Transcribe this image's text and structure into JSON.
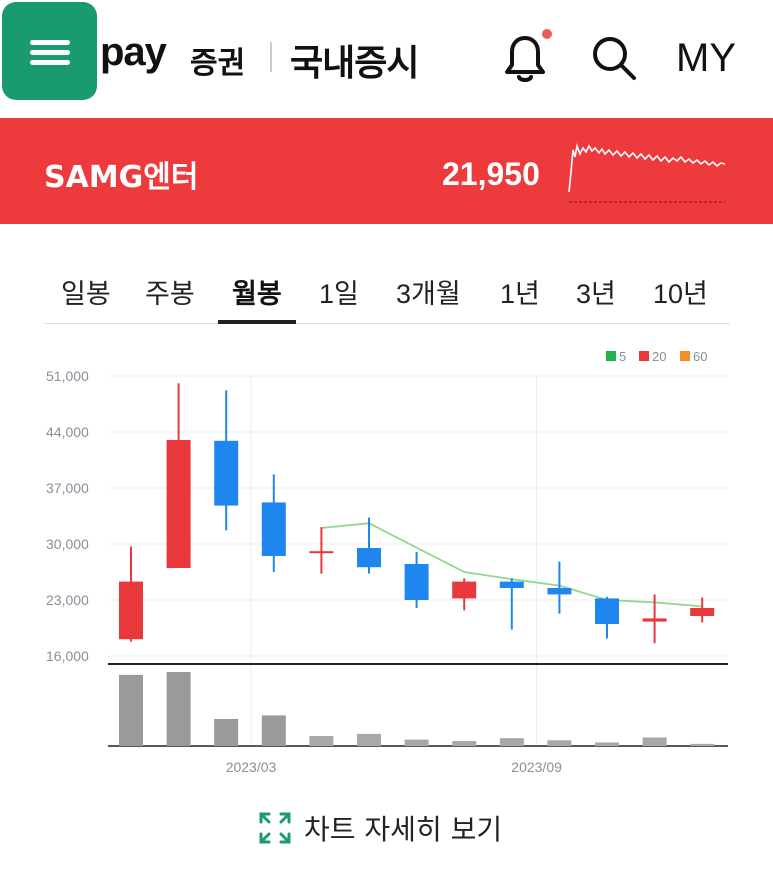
{
  "header": {
    "brand": "pay",
    "brand_sub": "증권",
    "section_title": "국내증시",
    "my_label": "MY",
    "notification_dot_color": "#f05a5a",
    "menu_color": "#1a9a70"
  },
  "stock": {
    "name": "SAMG엔터",
    "price": "21,950",
    "banner_color": "#ec3a3d"
  },
  "tabs": [
    {
      "label": "일봉",
      "active": false
    },
    {
      "label": "주봉",
      "active": false
    },
    {
      "label": "월봉",
      "active": true
    },
    {
      "label": "1일",
      "active": false
    },
    {
      "label": "3개월",
      "active": false
    },
    {
      "label": "1년",
      "active": false
    },
    {
      "label": "3년",
      "active": false
    },
    {
      "label": "10년",
      "active": false
    }
  ],
  "chart_data": {
    "type": "candlestick",
    "ylim": [
      16000,
      51000
    ],
    "y_ticks": [
      "51,000",
      "44,000",
      "37,000",
      "30,000",
      "23,000",
      "16,000"
    ],
    "y_tick_values": [
      51000,
      44000,
      37000,
      30000,
      23000,
      16000
    ],
    "x_tick_labels": [
      "2023/03",
      "2023/09"
    ],
    "x_tick_index": [
      3,
      9
    ],
    "legend": [
      {
        "label": "5",
        "color": "#22b14c"
      },
      {
        "label": "20",
        "color": "#e8383b"
      },
      {
        "label": "60",
        "color": "#f0922b"
      }
    ],
    "up_color": "#e8383b",
    "down_color": "#1f86f0",
    "ma_color": "#8fd98a",
    "candles": [
      {
        "open": 18100,
        "close": 25300,
        "high": 29700,
        "low": 17800,
        "volume": 100
      },
      {
        "open": 27000,
        "close": 43000,
        "high": 50100,
        "low": 27000,
        "volume": 104
      },
      {
        "open": 42900,
        "close": 34800,
        "high": 49200,
        "low": 31700,
        "volume": 38
      },
      {
        "open": 35200,
        "close": 28500,
        "high": 38700,
        "low": 26500,
        "volume": 43
      },
      {
        "open": 29000,
        "close": 29100,
        "high": 32100,
        "low": 26300,
        "volume": 14
      },
      {
        "open": 29500,
        "close": 27100,
        "high": 33300,
        "low": 26300,
        "volume": 17
      },
      {
        "open": 27500,
        "close": 23000,
        "high": 29000,
        "low": 22000,
        "volume": 9
      },
      {
        "open": 23200,
        "close": 25300,
        "high": 25700,
        "low": 21700,
        "volume": 7
      },
      {
        "open": 25300,
        "close": 24500,
        "high": 25700,
        "low": 19300,
        "volume": 11
      },
      {
        "open": 24500,
        "close": 23700,
        "high": 27800,
        "low": 21300,
        "volume": 8
      },
      {
        "open": 23200,
        "close": 20000,
        "high": 23400,
        "low": 18200,
        "volume": 5
      },
      {
        "open": 20300,
        "close": 20700,
        "high": 23700,
        "low": 17600,
        "volume": 12
      },
      {
        "open": 21000,
        "close": 22000,
        "high": 23300,
        "low": 20200,
        "volume": 3
      }
    ],
    "ma5": [
      null,
      null,
      null,
      null,
      32000,
      32600,
      null,
      26500,
      25600,
      24800,
      23000,
      22700,
      22200
    ]
  },
  "detail_link": {
    "label": "차트 자세히 보기",
    "icon_color": "#1a9a70"
  }
}
